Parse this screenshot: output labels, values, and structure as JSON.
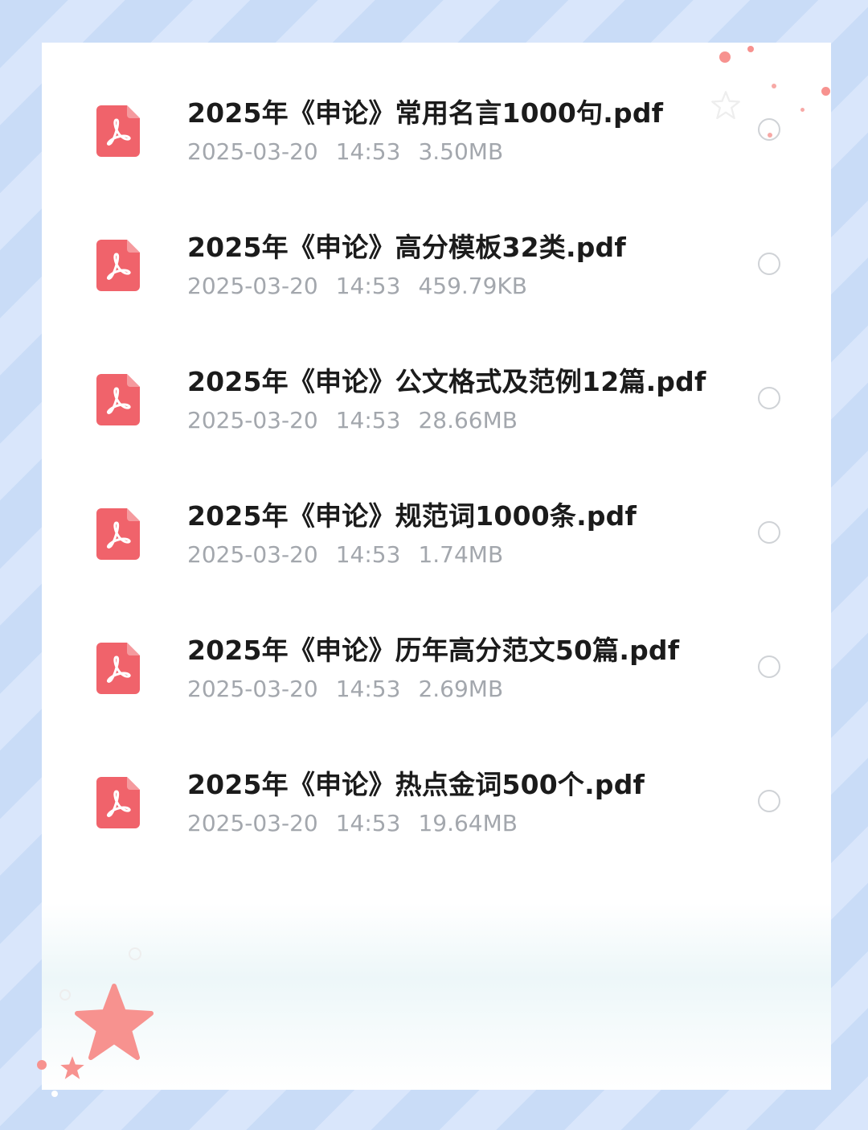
{
  "files": [
    {
      "name": "2025年《申论》常用名言1000句.pdf",
      "date": "2025-03-20",
      "time": "14:53",
      "size": "3.50MB"
    },
    {
      "name": "2025年《申论》高分模板32类.pdf",
      "date": "2025-03-20",
      "time": "14:53",
      "size": "459.79KB"
    },
    {
      "name": "2025年《申论》公文格式及范例12篇.pdf",
      "date": "2025-03-20",
      "time": "14:53",
      "size": "28.66MB"
    },
    {
      "name": "2025年《申论》规范词1000条.pdf",
      "date": "2025-03-20",
      "time": "14:53",
      "size": "1.74MB"
    },
    {
      "name": "2025年《申论》历年高分范文50篇.pdf",
      "date": "2025-03-20",
      "time": "14:53",
      "size": "2.69MB"
    },
    {
      "name": "2025年《申论》热点金词500个.pdf",
      "date": "2025-03-20",
      "time": "14:53",
      "size": "19.64MB"
    }
  ],
  "icons": {
    "file_type": "pdf-icon",
    "select": "radio-circle-icon",
    "decoration": "star-icon"
  },
  "colors": {
    "pdf_red": "#f0636b",
    "name_text": "#1b1b1b",
    "meta_text": "#a3a7ad",
    "star_pink": "#f7928f"
  }
}
